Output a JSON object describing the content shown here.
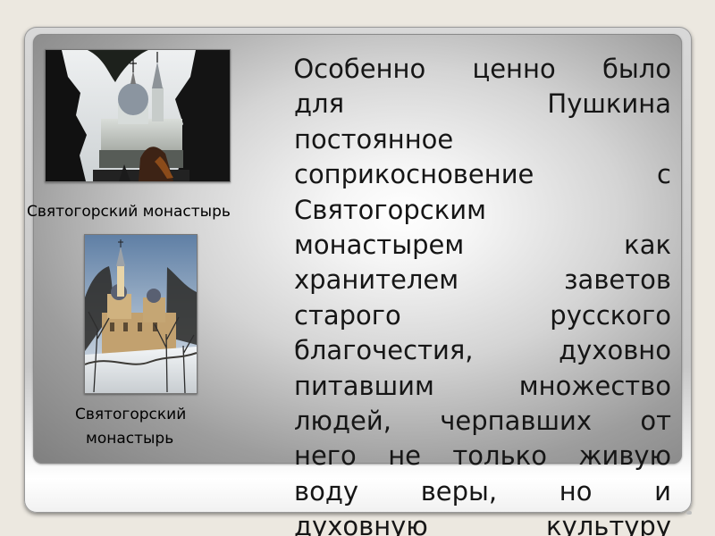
{
  "slide": {
    "captions": {
      "top": "Святогорский монастырь",
      "bottom_line_1": "Святогорский",
      "bottom_line_2": "монастырь"
    },
    "quote_lines": [
      "\"Особенно ценно было",
      "для Пушкина",
      "постоянное",
      "соприкосновение с",
      "Святогорским",
      "монастырем как",
      "хранителем заветов",
      "старого русского",
      "благочестия, духовно",
      "питавшим множество",
      "людей, черпавших от",
      "него не только живую",
      "воду веры, но и",
      "духовную культуру"
    ]
  }
}
